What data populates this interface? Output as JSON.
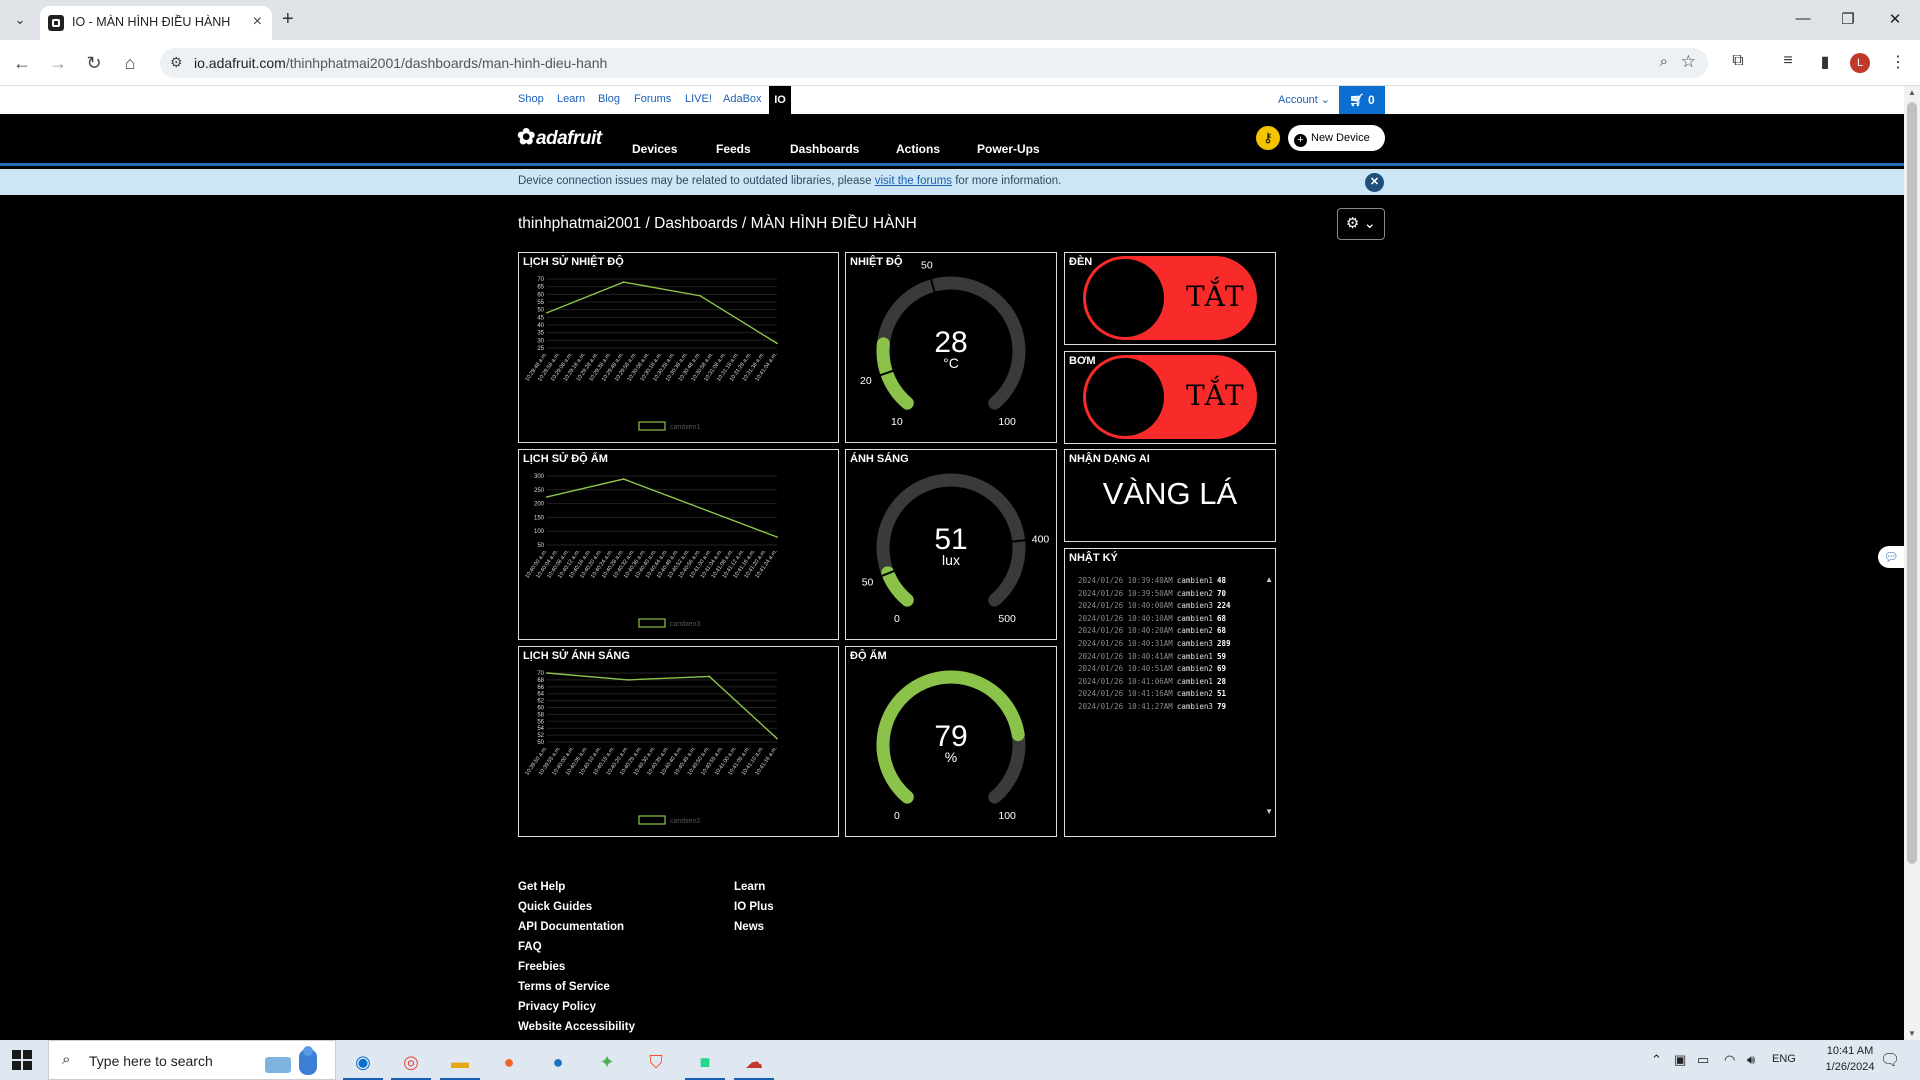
{
  "browser": {
    "tab_title": "IO - MÀN HÌNH ĐIỀU HÀNH",
    "url_domain": "io.adafruit.com",
    "url_path": "/thinhphatmai2001/dashboards/man-hinh-dieu-hanh",
    "profile_initial": "L"
  },
  "topnav": {
    "links": [
      "Shop",
      "Learn",
      "Blog",
      "Forums",
      "LIVE!",
      "AdaBox"
    ],
    "io_label": "IO",
    "account_label": "Account",
    "cart_count": "0"
  },
  "mainnav": {
    "logo_text": "adafruit",
    "items": [
      "Devices",
      "Feeds",
      "Dashboards",
      "Actions",
      "Power-Ups"
    ],
    "new_device_label": "New Device"
  },
  "notice": {
    "text_before": "Device connection issues may be related to outdated libraries, please ",
    "link_text": "visit the forums",
    "text_after": " for more information."
  },
  "breadcrumb": "thinhphatmai2001 / Dashboards / MÀN HÌNH ĐIỀU HÀNH",
  "blocks": {
    "temp_history": {
      "title": "LỊCH SỬ NHIỆT ĐỘ",
      "legend": "cambien1"
    },
    "humidity_history": {
      "title": "LỊCH SỬ ĐỘ ẨM",
      "legend": "cambien3"
    },
    "light_history": {
      "title": "LỊCH SỬ ÁNH SÁNG",
      "legend": "cambien2"
    },
    "temp_gauge": {
      "title": "NHIỆT ĐỘ",
      "value": "28",
      "unit": "°C",
      "min": "10",
      "max": "100",
      "low_threshold": "20",
      "high_threshold": "50"
    },
    "light_gauge": {
      "title": "ÁNH SÁNG",
      "value": "51",
      "unit": "lux",
      "min": "0",
      "max": "500",
      "low_threshold": "50",
      "high_threshold": "400"
    },
    "humidity_gauge": {
      "title": "ĐỘ ẨM",
      "value": "79",
      "unit": "%",
      "min": "0",
      "max": "100"
    },
    "light_toggle": {
      "title": "ĐÈN",
      "state": "TẮT"
    },
    "pump_toggle": {
      "title": "BƠM",
      "state": "TẮT"
    },
    "ai": {
      "title": "NHẬN DẠNG AI",
      "result": "VÀNG LÁ"
    },
    "log": {
      "title": "NHẬT KÝ",
      "entries": [
        {
          "ts": "2024/01/26 10:39:40AM",
          "feed": "cambien1",
          "value": "48"
        },
        {
          "ts": "2024/01/26 10:39:50AM",
          "feed": "cambien2",
          "value": "70"
        },
        {
          "ts": "2024/01/26 10:40:00AM",
          "feed": "cambien3",
          "value": "224"
        },
        {
          "ts": "2024/01/26 10:40:10AM",
          "feed": "cambien1",
          "value": "68"
        },
        {
          "ts": "2024/01/26 10:40:20AM",
          "feed": "cambien2",
          "value": "68"
        },
        {
          "ts": "2024/01/26 10:40:31AM",
          "feed": "cambien3",
          "value": "289"
        },
        {
          "ts": "2024/01/26 10:40:41AM",
          "feed": "cambien1",
          "value": "59"
        },
        {
          "ts": "2024/01/26 10:40:51AM",
          "feed": "cambien2",
          "value": "69"
        },
        {
          "ts": "2024/01/26 10:41:06AM",
          "feed": "cambien1",
          "value": "28"
        },
        {
          "ts": "2024/01/26 10:41:16AM",
          "feed": "cambien2",
          "value": "51"
        },
        {
          "ts": "2024/01/26 10:41:27AM",
          "feed": "cambien3",
          "value": "79"
        }
      ]
    }
  },
  "chart_data": [
    {
      "type": "line",
      "title": "LỊCH SỬ NHIỆT ĐỘ",
      "y_ticks": [
        "70",
        "65",
        "60",
        "55",
        "50",
        "45",
        "40",
        "35",
        "30",
        "25"
      ],
      "ylim": [
        25,
        70
      ],
      "x_tick_labels": [
        "10:28:48 a.m.",
        "10:28:58 a.m.",
        "10:29:08 a.m.",
        "10:29:18 a.m.",
        "10:29:28 a.m.",
        "10:29:38 a.m.",
        "10:29:48 a.m.",
        "10:29:58 a.m.",
        "10:30:08 a.m.",
        "10:30:18 a.m.",
        "10:30:28 a.m.",
        "10:30:38 a.m.",
        "10:30:48 a.m.",
        "10:30:58 a.m.",
        "10:31:08 a.m.",
        "10:31:18 a.m.",
        "10:31:28 a.m.",
        "10:31:38 a.m.",
        "10:41:04 a.m."
      ],
      "series": [
        {
          "name": "cambien1",
          "x_index": [
            0,
            6,
            12,
            18
          ],
          "values": [
            48,
            68,
            59,
            28
          ]
        }
      ],
      "color": "#8bc34a"
    },
    {
      "type": "line",
      "title": "LỊCH SỬ ĐỘ ẨM",
      "y_ticks": [
        "300",
        "250",
        "200",
        "150",
        "100",
        "50"
      ],
      "ylim": [
        50,
        300
      ],
      "x_tick_labels": [
        "10:40:00 a.m.",
        "10:40:04 a.m.",
        "10:40:08 a.m.",
        "10:40:12 a.m.",
        "10:40:16 a.m.",
        "10:40:20 a.m.",
        "10:40:24 a.m.",
        "10:40:28 a.m.",
        "10:40:32 a.m.",
        "10:40:36 a.m.",
        "10:40:40 a.m.",
        "10:40:44 a.m.",
        "10:40:48 a.m.",
        "10:40:52 a.m.",
        "10:40:56 a.m.",
        "10:41:00 a.m.",
        "10:41:04 a.m.",
        "10:41:08 a.m.",
        "10:41:12 a.m.",
        "10:41:16 a.m.",
        "10:41:20 a.m.",
        "10:41:24 a.m."
      ],
      "series": [
        {
          "name": "cambien3",
          "x_index": [
            0,
            7,
            21
          ],
          "values": [
            224,
            289,
            79
          ]
        }
      ],
      "color": "#8bc34a"
    },
    {
      "type": "line",
      "title": "LỊCH SỬ ÁNH SÁNG",
      "y_ticks": [
        "70",
        "68",
        "66",
        "64",
        "62",
        "60",
        "58",
        "56",
        "54",
        "52",
        "50"
      ],
      "ylim": [
        50,
        70
      ],
      "x_tick_labels": [
        "10:39:50 a.m.",
        "10:39:55 a.m.",
        "10:40:00 a.m.",
        "10:40:05 a.m.",
        "10:40:10 a.m.",
        "10:40:15 a.m.",
        "10:40:20 a.m.",
        "10:40:25 a.m.",
        "10:40:30 a.m.",
        "10:40:35 a.m.",
        "10:40:40 a.m.",
        "10:40:45 a.m.",
        "10:40:50 a.m.",
        "10:40:55 a.m.",
        "10:41:00 a.m.",
        "10:41:05 a.m.",
        "10:41:10 a.m.",
        "10:41:16 a.m."
      ],
      "series": [
        {
          "name": "cambien2",
          "x_index": [
            0,
            6,
            12,
            17
          ],
          "values": [
            70,
            68,
            69,
            51
          ]
        }
      ],
      "color": "#8bc34a"
    }
  ],
  "footer": {
    "col1": [
      "Get Help",
      "Quick Guides",
      "API Documentation",
      "FAQ",
      "Freebies",
      "Terms of Service",
      "Privacy Policy",
      "Website Accessibility"
    ],
    "col2": [
      "Learn",
      "IO Plus",
      "News"
    ]
  },
  "taskbar": {
    "search_placeholder": "Type here to search",
    "language": "ENG",
    "time": "10:41 AM",
    "date": "1/26/2024"
  }
}
